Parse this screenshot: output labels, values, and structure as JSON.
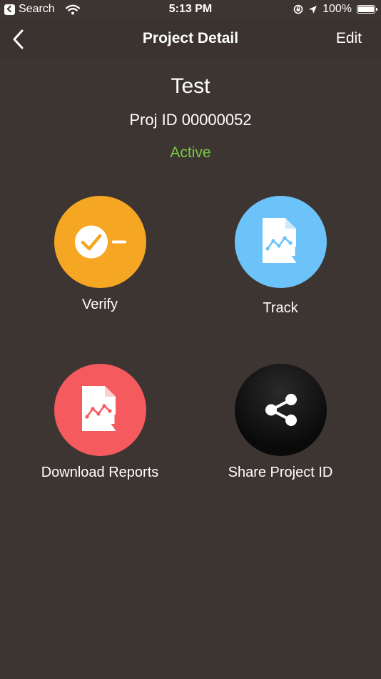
{
  "status_bar": {
    "back_app": "Search",
    "time": "5:13 PM",
    "battery": "100%"
  },
  "nav": {
    "title": "Project Detail",
    "edit_label": "Edit"
  },
  "project": {
    "name": "Test",
    "id_text": "Proj ID 00000052",
    "status": "Active",
    "status_color": "#7ac943"
  },
  "actions": [
    {
      "label": "Verify",
      "icon": "verify-icon",
      "color": "#f5a623"
    },
    {
      "label": "Track",
      "icon": "track-report-icon",
      "color": "#6cc3f9"
    },
    {
      "label": "Download Reports",
      "icon": "download-report-icon",
      "color": "#f55b5e"
    },
    {
      "label": "Share Project ID",
      "icon": "share-icon",
      "color": "#111111"
    }
  ],
  "colors": {
    "background": "#3d3532",
    "nav_background": "#3a3330",
    "text": "#ffffff"
  }
}
